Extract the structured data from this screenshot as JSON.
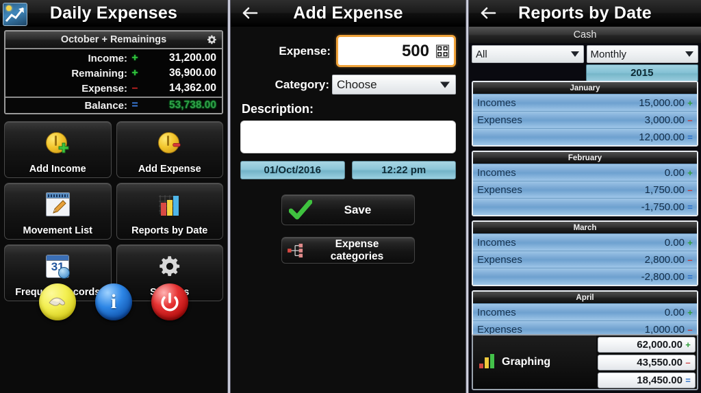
{
  "panel1": {
    "app_icon": "chart-photo-icon",
    "title": "Daily Expenses",
    "summary": {
      "header": "October + Remainings",
      "gear_icon": "gear-icon",
      "rows": [
        {
          "label": "Income:",
          "mark": "+",
          "mark_type": "plus",
          "value": "31,200.00"
        },
        {
          "label": "Remaining:",
          "mark": "+",
          "mark_type": "plus",
          "value": "36,900.00"
        },
        {
          "label": "Expense:",
          "mark": "–",
          "mark_type": "minus",
          "value": "14,362.00"
        }
      ],
      "balance": {
        "label": "Balance:",
        "mark": "=",
        "mark_type": "eq",
        "value": "53,738.00",
        "value_color": "#2f9c46"
      }
    },
    "buttons": [
      {
        "label": "Add Income",
        "icon": "coin-plus-icon"
      },
      {
        "label": "Add Expense",
        "icon": "coin-minus-icon"
      },
      {
        "label": "Movement List",
        "icon": "note-pencil-icon"
      },
      {
        "label": "Reports by Date",
        "icon": "bar-chart-icon"
      },
      {
        "label": "Frequent Records",
        "icon": "calendar-clock-icon"
      },
      {
        "label": "Settings",
        "icon": "gear-icon"
      }
    ],
    "round_buttons": [
      {
        "name": "donate-icon",
        "color": "#f0ec4c"
      },
      {
        "name": "info-icon",
        "color": "#2d86e6",
        "glyph": "i"
      },
      {
        "name": "power-exit-icon",
        "color": "#e63333"
      }
    ]
  },
  "panel2": {
    "back_icon": "back-arrow-icon",
    "title": "Add Expense",
    "expense_label": "Expense:",
    "expense_value": "500",
    "keypad_icon": "keypad-icon",
    "category_label": "Category:",
    "category_value": "Choose",
    "description_label": "Description:",
    "description_value": "",
    "date_value": "01/Oct/2016",
    "time_value": "12:22 pm",
    "save_label": "Save",
    "save_icon": "green-check-icon",
    "categories_label": "Expense categories",
    "categories_icon": "category-tree-icon"
  },
  "panel3": {
    "back_icon": "back-arrow-icon",
    "title": "Reports by Date",
    "account_label": "Cash",
    "filter_value": "All",
    "period_value": "Monthly",
    "year_value": "2015",
    "row_labels": {
      "incomes": "Incomes",
      "expenses": "Expenses"
    },
    "months": [
      {
        "name": "January",
        "incomes": "15,000.00",
        "expenses": "3,000.00",
        "balance": "12,000.00"
      },
      {
        "name": "February",
        "incomes": "0.00",
        "expenses": "1,750.00",
        "balance": "-1,750.00"
      },
      {
        "name": "March",
        "incomes": "0.00",
        "expenses": "2,800.00",
        "balance": "-2,800.00"
      },
      {
        "name": "April",
        "incomes": "0.00",
        "expenses": "1,000.00",
        "balance": ""
      }
    ],
    "graphing_label": "Graphing",
    "graphing_icon": "bar-chart-icon",
    "totals": [
      {
        "value": "62,000.00",
        "sign": "+",
        "sign_type": "p"
      },
      {
        "value": "43,550.00",
        "sign": "–",
        "sign_type": "m"
      },
      {
        "value": "18,450.00",
        "sign": "=",
        "sign_type": "e"
      }
    ]
  }
}
